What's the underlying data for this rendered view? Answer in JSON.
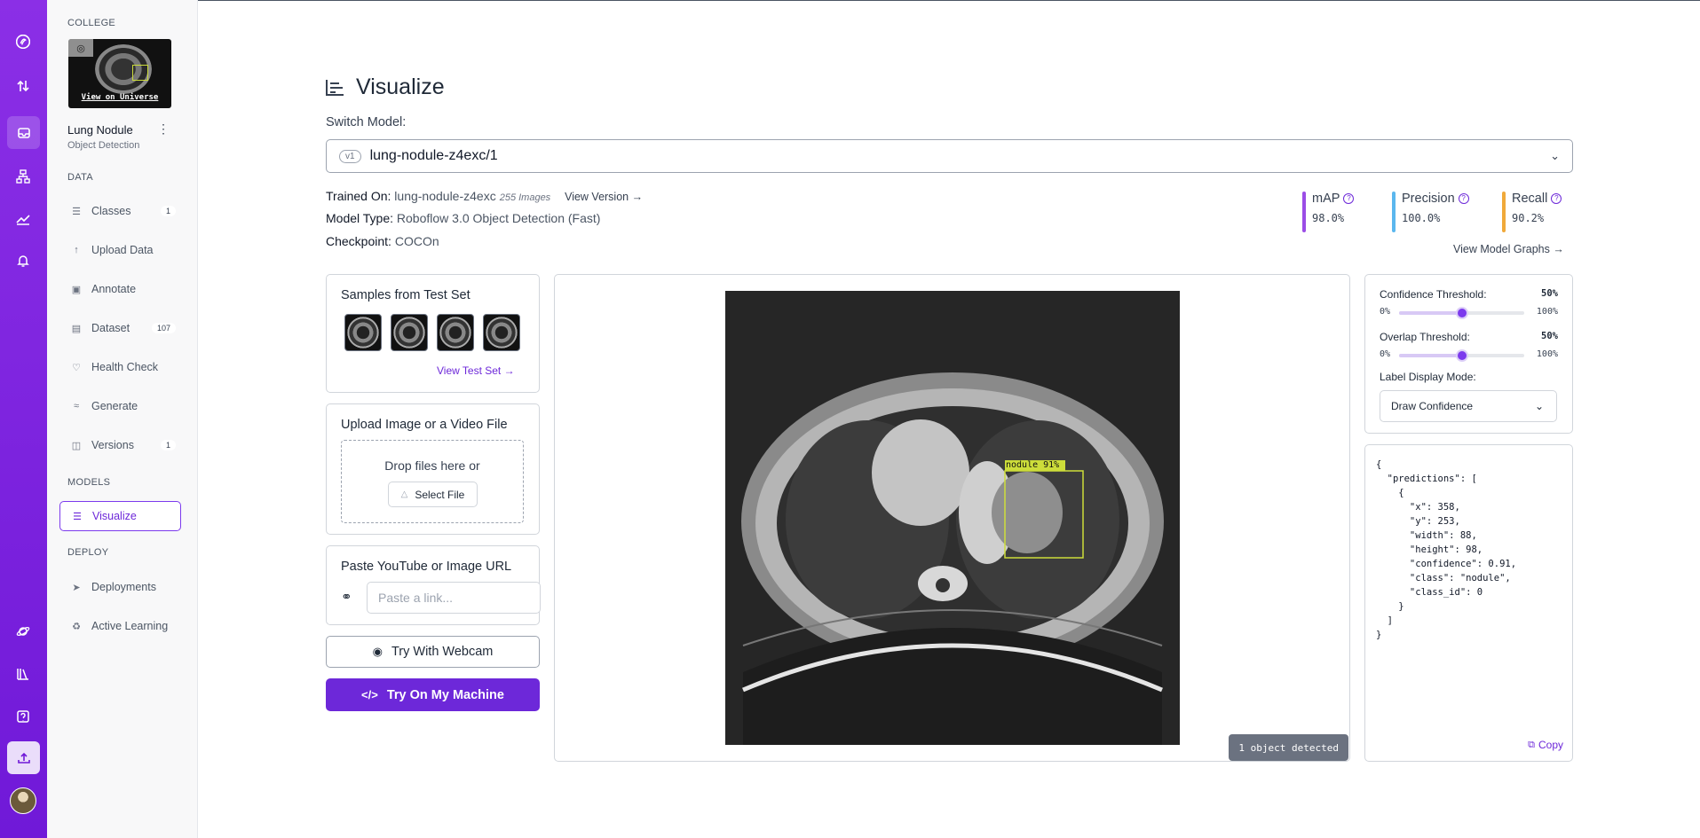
{
  "workspace": {
    "label": "COLLEGE"
  },
  "project": {
    "name": "Lung Nodule",
    "type": "Object Detection",
    "universe_link": "View on Universe"
  },
  "sidebar": {
    "data_section": "DATA",
    "models_section": "MODELS",
    "deploy_section": "DEPLOY",
    "items": [
      {
        "label": "Classes",
        "badge": "1"
      },
      {
        "label": "Upload Data"
      },
      {
        "label": "Annotate"
      },
      {
        "label": "Dataset",
        "badge": "107"
      },
      {
        "label": "Health Check"
      },
      {
        "label": "Generate"
      },
      {
        "label": "Versions",
        "badge": "1"
      },
      {
        "label": "Visualize"
      },
      {
        "label": "Deployments"
      },
      {
        "label": "Active Learning"
      }
    ]
  },
  "page": {
    "title": "Visualize",
    "switch_model_label": "Switch Model:"
  },
  "model": {
    "version_badge": "v1",
    "selected": "lung-nodule-z4exc/1",
    "trained_on_label": "Trained On:",
    "trained_on": "lung-nodule-z4exc",
    "image_count": "255 Images",
    "view_version": "View Version →",
    "model_type_label": "Model Type:",
    "model_type": "Roboflow 3.0 Object Detection (Fast)",
    "checkpoint_label": "Checkpoint:",
    "checkpoint": "COCOn"
  },
  "metrics": [
    {
      "name": "mAP",
      "value": "98.0%",
      "color": "#9b4de6"
    },
    {
      "name": "Precision",
      "value": "100.0%",
      "color": "#5bb7ee"
    },
    {
      "name": "Recall",
      "value": "90.2%",
      "color": "#f0a93a"
    }
  ],
  "view_model_graphs": "View Model Graphs →",
  "samples": {
    "title": "Samples from Test Set",
    "link": "View Test Set →",
    "count": 4
  },
  "upload": {
    "title": "Upload Image or a Video File",
    "drop_text": "Drop files here or",
    "select_button": "Select File"
  },
  "url_input": {
    "title": "Paste YouTube or Image URL",
    "placeholder": "Paste a link..."
  },
  "webcam_button": "Try With Webcam",
  "machine_button": "Try On My Machine",
  "detection": {
    "label": "nodule 91%",
    "status": "1 object detected"
  },
  "controls": {
    "confidence_label": "Confidence Threshold:",
    "confidence_value": "50%",
    "confidence_level": 0.5,
    "overlap_label": "Overlap Threshold:",
    "overlap_value": "50%",
    "overlap_level": 0.5,
    "min_label": "0%",
    "max_label": "100%",
    "label_mode_label": "Label Display Mode:",
    "label_mode": "Draw Confidence"
  },
  "json_output": "{\n  \"predictions\": [\n    {\n      \"x\": 358,\n      \"y\": 253,\n      \"width\": 88,\n      \"height\": 98,\n      \"confidence\": 0.91,\n      \"class\": \"nodule\",\n      \"class_id\": 0\n    }\n  ]\n}",
  "copy_label": "Copy",
  "colors": {
    "brand": "#7019d8",
    "accent": "#6d28d9",
    "detection_box": "#cddd3a"
  }
}
